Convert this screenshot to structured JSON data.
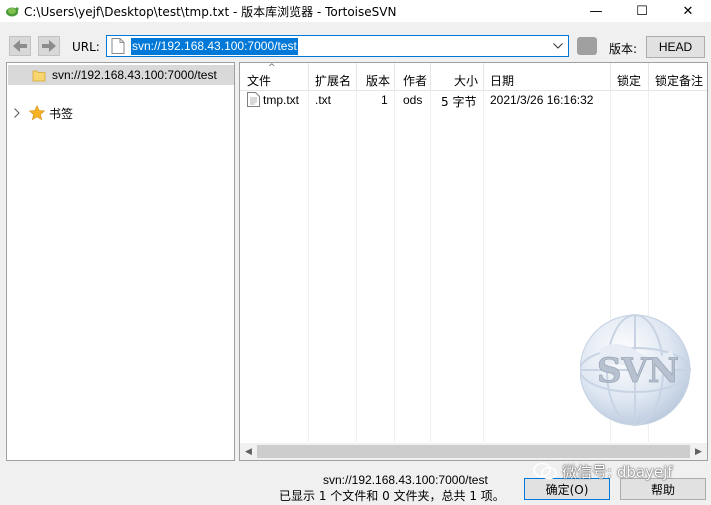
{
  "window": {
    "title": "C:\\Users\\yejf\\Desktop\\test\\tmp.txt - 版本库浏览器 - TortoiseSVN",
    "minimize": "—",
    "maximize": "☐",
    "close": "✕"
  },
  "toolbar": {
    "url_label": "URL:",
    "url_value": "svn://192.168.43.100:7000/test",
    "revision_label": "版本:",
    "revision_button": "HEAD"
  },
  "tree": {
    "root_label": "svn://192.168.43.100:7000/test",
    "bookmarks_label": "书签"
  },
  "list": {
    "columns": [
      "文件",
      "扩展名",
      "版本",
      "作者",
      "大小",
      "日期",
      "锁定",
      "锁定备注"
    ],
    "rows": [
      {
        "file": "tmp.txt",
        "ext": ".txt",
        "rev": "1",
        "author": "ods",
        "size": "5 字节",
        "date": "2021/3/26 16:16:32",
        "lock": "",
        "lock_comment": ""
      }
    ]
  },
  "watermark": {
    "text": "SVN"
  },
  "status": {
    "url": "svn://192.168.43.100:7000/test",
    "count_text": "已显示 1 个文件和 0 文件夹，总共 1 项。"
  },
  "buttons": {
    "ok": "确定(O)",
    "help": "帮助"
  },
  "overlay": {
    "text": "微信号: dbayejf"
  },
  "colors": {
    "accent": "#0078d7",
    "selection": "#d9d9d9"
  }
}
